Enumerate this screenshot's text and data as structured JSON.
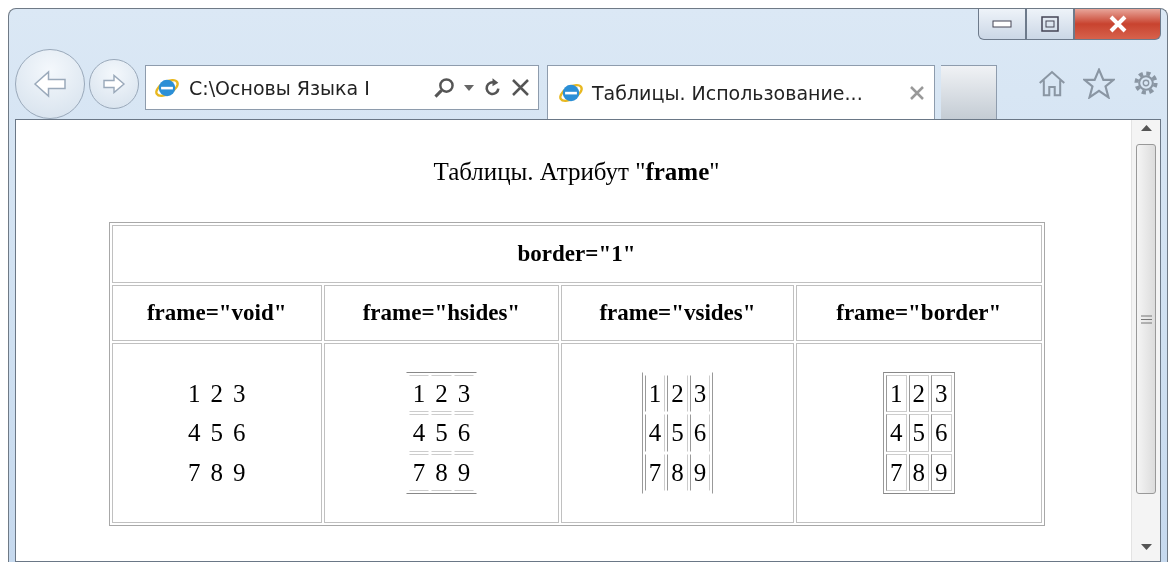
{
  "browser": {
    "address": "C:\\Основы Языка I",
    "tabs": [
      {
        "title": "Таблицы. Использование...",
        "selected": true
      }
    ]
  },
  "page": {
    "heading": "Таблицы. Атрибут \"**frame**\"",
    "table": {
      "caption": "border=\"1\"",
      "columns": [
        {
          "header": "frame=\"void\"",
          "kind": "void",
          "rows": [
            [
              "1",
              "2",
              "3"
            ],
            [
              "4",
              "5",
              "6"
            ],
            [
              "7",
              "8",
              "9"
            ]
          ]
        },
        {
          "header": "frame=\"hsides\"",
          "kind": "hsides",
          "rows": [
            [
              "1",
              "2",
              "3"
            ],
            [
              "4",
              "5",
              "6"
            ],
            [
              "7",
              "8",
              "9"
            ]
          ]
        },
        {
          "header": "frame=\"vsides\"",
          "kind": "vsides",
          "rows": [
            [
              "1",
              "2",
              "3"
            ],
            [
              "4",
              "5",
              "6"
            ],
            [
              "7",
              "8",
              "9"
            ]
          ]
        },
        {
          "header": "frame=\"border\"",
          "kind": "border",
          "rows": [
            [
              "1",
              "2",
              "3"
            ],
            [
              "4",
              "5",
              "6"
            ],
            [
              "7",
              "8",
              "9"
            ]
          ]
        }
      ]
    }
  }
}
